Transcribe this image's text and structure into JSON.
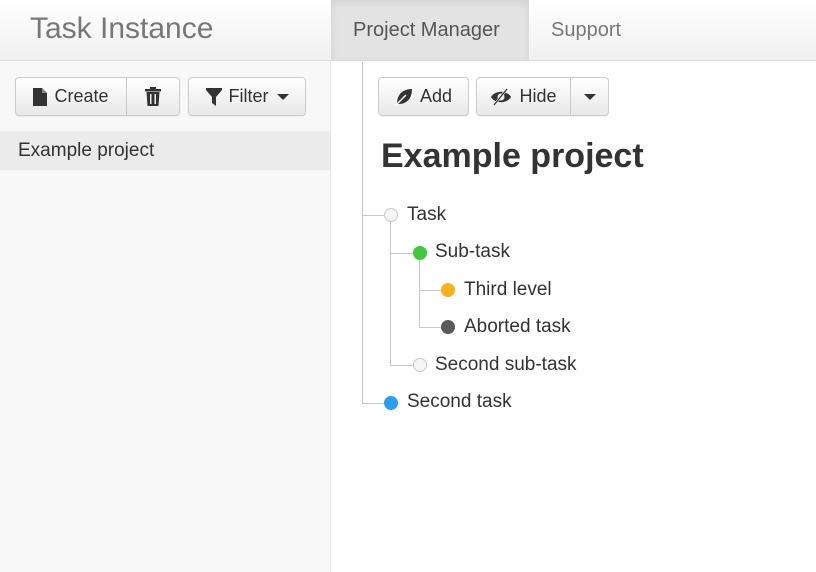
{
  "navbar": {
    "brand": "Task Instance",
    "tabs": [
      {
        "label": "Project Manager",
        "active": true
      },
      {
        "label": "Support",
        "active": false
      }
    ]
  },
  "sidebar": {
    "toolbar": {
      "create_label": "Create",
      "delete_icon": "trash-icon",
      "filter_label": "Filter"
    },
    "projects": [
      {
        "label": "Example project",
        "selected": true
      }
    ]
  },
  "main": {
    "toolbar": {
      "add_label": "Add",
      "hide_label": "Hide"
    },
    "title": "Example project",
    "tasks": [
      {
        "label": "Task",
        "status_color": "#f5f5f5"
      },
      {
        "label": "Sub-task",
        "status_color": "#3ec93e"
      },
      {
        "label": "Third level",
        "status_color": "#f5b31c"
      },
      {
        "label": "Aborted task",
        "status_color": "#5a5a5a"
      },
      {
        "label": "Second sub-task",
        "status_color": "#f5f5f5"
      },
      {
        "label": "Second task",
        "status_color": "#2a9ff0"
      }
    ]
  }
}
